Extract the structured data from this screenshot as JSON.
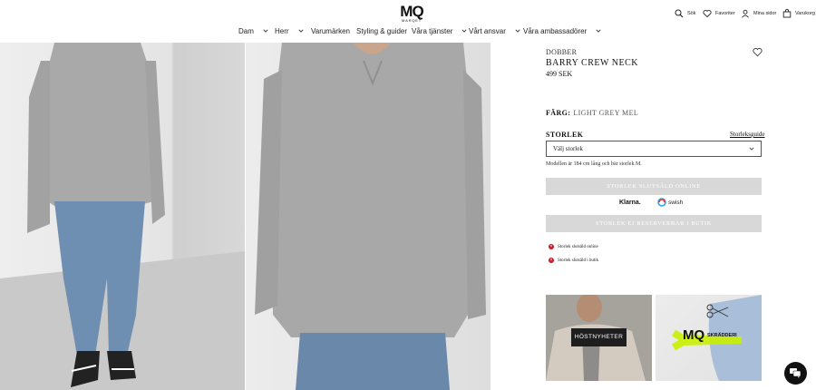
{
  "header": {
    "logo": "MQ",
    "logo_sub": "MARQET",
    "utility": [
      {
        "label": "Sök",
        "icon": "search-icon"
      },
      {
        "label": "Favoriter",
        "icon": "heart-icon"
      },
      {
        "label": "Mina sidor",
        "icon": "user-icon"
      },
      {
        "label": "Varukorg",
        "icon": "bag-icon"
      }
    ],
    "nav": [
      {
        "label": "Dam",
        "has_dropdown": true
      },
      {
        "label": "Herr",
        "has_dropdown": true
      },
      {
        "label": "Varumärken",
        "has_dropdown": false
      },
      {
        "label": "Styling & guider",
        "has_dropdown": false
      },
      {
        "label": "Våra tjänster",
        "has_dropdown": true
      },
      {
        "label": "Vårt ansvar",
        "has_dropdown": true
      },
      {
        "label": "Våra ambassadörer",
        "has_dropdown": true
      }
    ]
  },
  "product": {
    "brand": "DOBBER",
    "name": "BARRY CREW NECK",
    "price": "499 SEK",
    "color_label": "FÄRG:",
    "color_value": "LIGHT GREY MEL",
    "size_label": "STORLEK",
    "size_guide": "Storleksguide",
    "size_select": "Välj storlek",
    "model_note": "Modellen är 184 cm lång och bär storlek M.",
    "button_online": "STORLEK SLUTSÅLD ONLINE",
    "button_store": "STORLEK EJ RESERVERBAR I BUTIK",
    "payment": {
      "klarna": "Klarna.",
      "swish": "swish"
    },
    "stock": [
      {
        "text": "Storlek slutsåld online"
      },
      {
        "text": "Storlek slutsåld i butik"
      }
    ]
  },
  "promos": [
    {
      "label": "HÖSTNYHETER"
    },
    {
      "logo": "MQ",
      "label": "SKRÄDDERI"
    }
  ],
  "colors": {
    "accent_disabled": "#d8d8d8",
    "status_red": "#c9182b",
    "promo_lime": "#c8f000"
  }
}
